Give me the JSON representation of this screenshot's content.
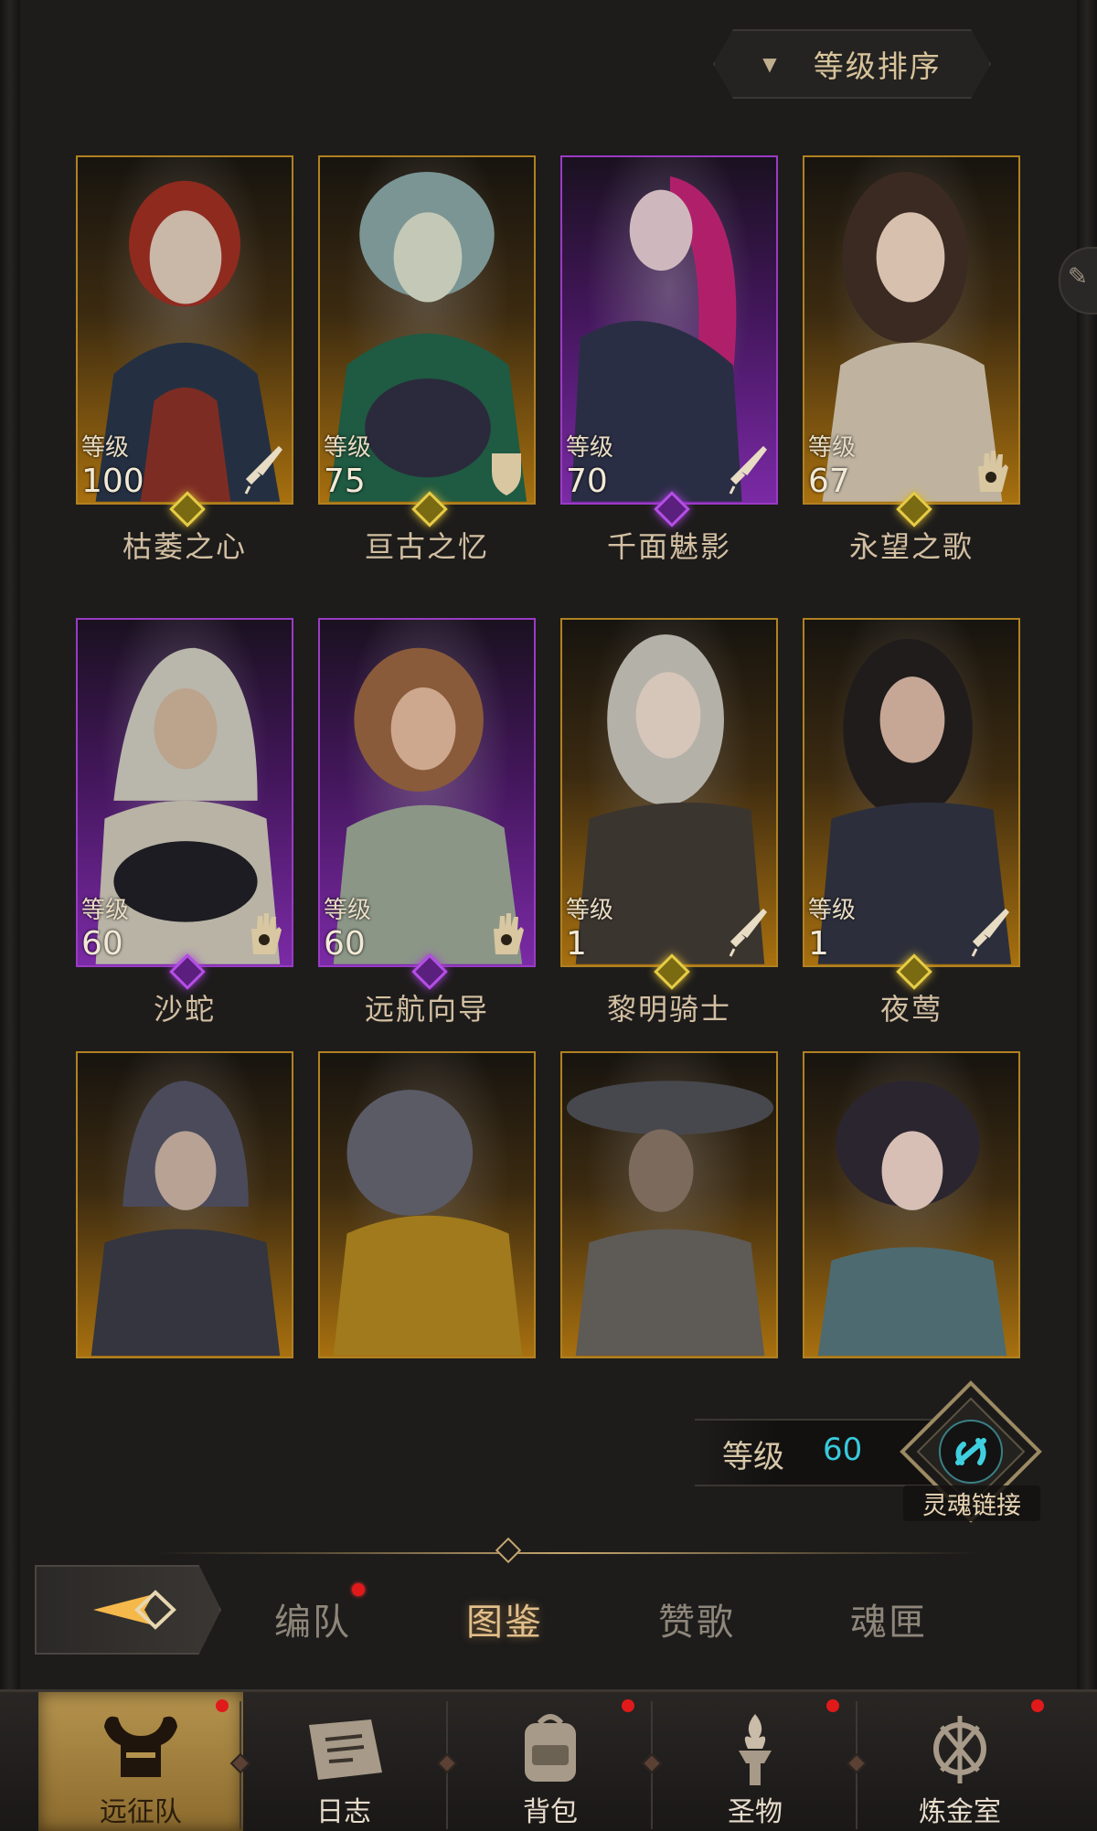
{
  "sort": {
    "label": "等级排序"
  },
  "heroes": [
    {
      "name": "枯萎之心",
      "level_label": "等级",
      "level": "100",
      "frame": "gold",
      "class_icon": "sword-icon"
    },
    {
      "name": "亘古之忆",
      "level_label": "等级",
      "level": "75",
      "frame": "gold",
      "class_icon": "shield-icon"
    },
    {
      "name": "千面魅影",
      "level_label": "等级",
      "level": "70",
      "frame": "purple",
      "class_icon": "sword-icon"
    },
    {
      "name": "永望之歌",
      "level_label": "等级",
      "level": "67",
      "frame": "gold",
      "class_icon": "hand-icon"
    },
    {
      "name": "沙蛇",
      "level_label": "等级",
      "level": "60",
      "frame": "purple",
      "class_icon": "hand-icon"
    },
    {
      "name": "远航向导",
      "level_label": "等级",
      "level": "60",
      "frame": "purple",
      "class_icon": "hand-icon"
    },
    {
      "name": "黎明骑士",
      "level_label": "等级",
      "level": "1",
      "frame": "gold",
      "class_icon": "sword-icon"
    },
    {
      "name": "夜莺",
      "level_label": "等级",
      "level": "1",
      "frame": "gold",
      "class_icon": "sword-icon"
    }
  ],
  "locked_heroes": 4,
  "soul_link": {
    "level_label": "等级",
    "level": "60",
    "label": "灵魂链接",
    "accent": "#39c9dc"
  },
  "tabs": [
    {
      "label": "编队",
      "active": false,
      "badge": true
    },
    {
      "label": "图鉴",
      "active": true,
      "badge": false
    },
    {
      "label": "赞歌",
      "active": false,
      "badge": false
    },
    {
      "label": "魂匣",
      "active": false,
      "badge": false
    }
  ],
  "bottom_nav": [
    {
      "label": "远征队",
      "active": true,
      "badge": true,
      "icon": "helmet-icon"
    },
    {
      "label": "日志",
      "active": false,
      "badge": false,
      "icon": "scroll-icon"
    },
    {
      "label": "背包",
      "active": false,
      "badge": true,
      "icon": "backpack-icon"
    },
    {
      "label": "圣物",
      "active": false,
      "badge": true,
      "icon": "torch-icon"
    },
    {
      "label": "炼金室",
      "active": false,
      "badge": true,
      "icon": "alchemy-icon"
    }
  ],
  "colors": {
    "gold_frame": "#b08121",
    "purple_frame": "#9a3bc4",
    "badge": "#e01a1a",
    "tab_active": "#e2bf8b"
  }
}
